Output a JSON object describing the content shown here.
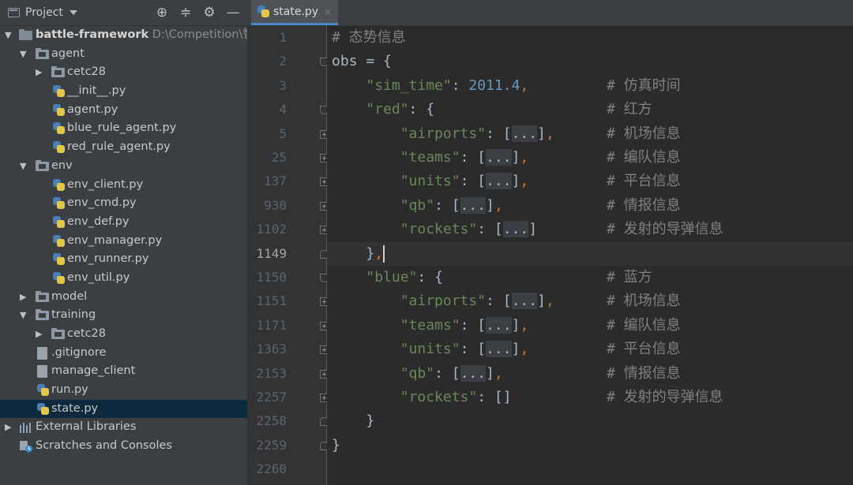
{
  "project_panel": {
    "title": "Project",
    "toolbar_icons": [
      "locate-icon",
      "collapse-all-icon",
      "gear-icon",
      "minimize-icon"
    ],
    "tree": [
      {
        "label": "battle-framework",
        "path": "D:\\Competition\\智能",
        "type": "root"
      },
      {
        "label": "agent",
        "type": "folder"
      },
      {
        "label": "cetc28",
        "type": "folder"
      },
      {
        "label": "__init__.py",
        "type": "py"
      },
      {
        "label": "agent.py",
        "type": "py"
      },
      {
        "label": "blue_rule_agent.py",
        "type": "py"
      },
      {
        "label": "red_rule_agent.py",
        "type": "py"
      },
      {
        "label": "env",
        "type": "folder"
      },
      {
        "label": "env_client.py",
        "type": "py"
      },
      {
        "label": "env_cmd.py",
        "type": "py"
      },
      {
        "label": "env_def.py",
        "type": "py"
      },
      {
        "label": "env_manager.py",
        "type": "py"
      },
      {
        "label": "env_runner.py",
        "type": "py"
      },
      {
        "label": "env_util.py",
        "type": "py"
      },
      {
        "label": "model",
        "type": "folder"
      },
      {
        "label": "training",
        "type": "folder"
      },
      {
        "label": "cetc28",
        "type": "folder"
      },
      {
        "label": ".gitignore",
        "type": "file"
      },
      {
        "label": "manage_client",
        "type": "file"
      },
      {
        "label": "run.py",
        "type": "py"
      },
      {
        "label": "state.py",
        "type": "py"
      },
      {
        "label": "External Libraries",
        "type": "lib"
      },
      {
        "label": "Scratches and Consoles",
        "type": "scratch"
      }
    ]
  },
  "editor": {
    "tab": {
      "label": "state.py",
      "close": "×"
    },
    "lines": [
      {
        "no": "1",
        "code": "# 态势信息",
        "comment": ""
      },
      {
        "no": "2",
        "code": "obs = {",
        "comment": ""
      },
      {
        "no": "3",
        "code": "    \"sim_time\": 2011.4,",
        "comment": "# 仿真时间"
      },
      {
        "no": "4",
        "code": "    \"red\": {",
        "comment": "# 红方"
      },
      {
        "no": "5",
        "code": "        \"airports\": [...],",
        "comment": "# 机场信息"
      },
      {
        "no": "25",
        "code": "        \"teams\": [...],",
        "comment": "# 编队信息"
      },
      {
        "no": "137",
        "code": "        \"units\": [...],",
        "comment": "# 平台信息"
      },
      {
        "no": "930",
        "code": "        \"qb\": [...],",
        "comment": "# 情报信息"
      },
      {
        "no": "1102",
        "code": "        \"rockets\": [...]",
        "comment": "# 发射的导弹信息"
      },
      {
        "no": "1149",
        "code": "    },",
        "comment": ""
      },
      {
        "no": "1150",
        "code": "    \"blue\": {",
        "comment": "# 蓝方"
      },
      {
        "no": "1151",
        "code": "        \"airports\": [...],",
        "comment": "# 机场信息"
      },
      {
        "no": "1171",
        "code": "        \"teams\": [...],",
        "comment": "# 编队信息"
      },
      {
        "no": "1363",
        "code": "        \"units\": [...],",
        "comment": "# 平台信息"
      },
      {
        "no": "2153",
        "code": "        \"qb\": [...],",
        "comment": "# 情报信息"
      },
      {
        "no": "2257",
        "code": "        \"rockets\": []",
        "comment": "# 发射的导弹信息"
      },
      {
        "no": "2258",
        "code": "    }",
        "comment": ""
      },
      {
        "no": "2259",
        "code": "}",
        "comment": ""
      },
      {
        "no": "2260",
        "code": "",
        "comment": ""
      }
    ],
    "current_line": "1149"
  },
  "colors": {
    "string": "#6a8759",
    "number": "#6897bb",
    "punctuation": "#cc7832",
    "comment": "#808080",
    "selection": "#0d293e",
    "tab_underline": "#4a88c7"
  }
}
